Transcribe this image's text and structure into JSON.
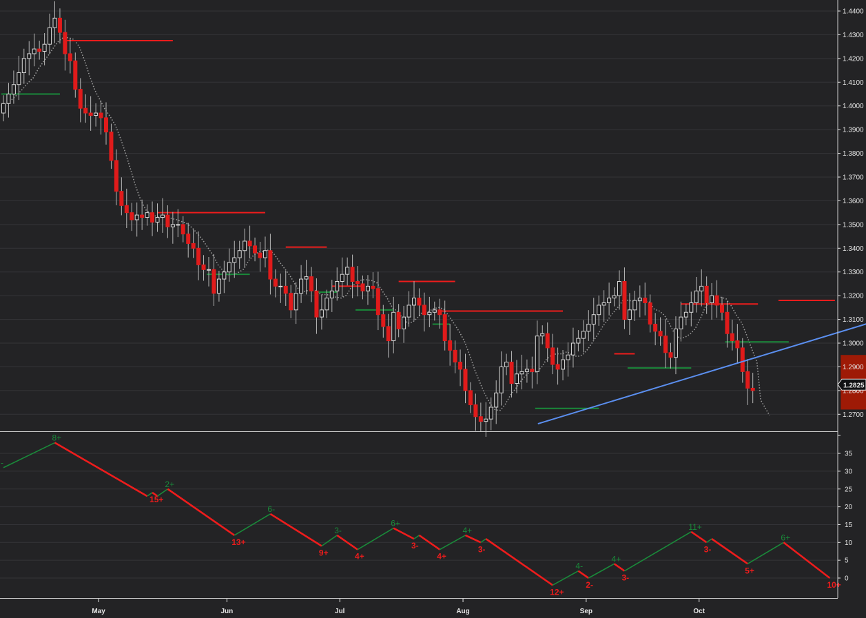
{
  "colors": {
    "background": "#232325",
    "grid": "#343438",
    "up_candle": "#d9d9d9",
    "down_candle": "#e01b1b",
    "wick": "#b8b8b8",
    "red_line": "#ee1c1c",
    "green_line": "#1a8a3a",
    "trendline": "#5b8ff0",
    "target_box": "#9e1a06",
    "ma": "#9a9a9a",
    "axis_text": "#e6e6e6"
  },
  "chart_data": [
    {
      "type": "candlestick",
      "title": "",
      "ylim": [
        1.262,
        1.446
      ],
      "yticks": [
        "1.2700",
        "1.2800",
        "1.2900",
        "1.3000",
        "1.3100",
        "1.3200",
        "1.3300",
        "1.3400",
        "1.3500",
        "1.3600",
        "1.3700",
        "1.3800",
        "1.3900",
        "1.4000",
        "1.4100",
        "1.4200",
        "1.4300",
        "1.4400"
      ],
      "xticks": [
        "May",
        "Jun",
        "Jul",
        "Aug",
        "Sep",
        "Oct"
      ],
      "last_price_label": "1.2825",
      "last_price": 1.2825,
      "closes": [
        1.401,
        1.405,
        1.409,
        1.414,
        1.42,
        1.422,
        1.424,
        1.423,
        1.426,
        1.433,
        1.437,
        1.431,
        1.422,
        1.419,
        1.407,
        1.399,
        1.397,
        1.396,
        1.397,
        1.395,
        1.389,
        1.377,
        1.364,
        1.358,
        1.355,
        1.352,
        1.354,
        1.353,
        1.355,
        1.351,
        1.353,
        1.354,
        1.349,
        1.35,
        1.35,
        1.346,
        1.342,
        1.34,
        1.333,
        1.331,
        1.331,
        1.321,
        1.327,
        1.33,
        1.334,
        1.336,
        1.339,
        1.343,
        1.341,
        1.338,
        1.336,
        1.339,
        1.327,
        1.324,
        1.324,
        1.321,
        1.314,
        1.321,
        1.327,
        1.328,
        1.322,
        1.311,
        1.314,
        1.319,
        1.322,
        1.326,
        1.329,
        1.332,
        1.326,
        1.325,
        1.322,
        1.324,
        1.323,
        1.312,
        1.307,
        1.301,
        1.313,
        1.306,
        1.311,
        1.316,
        1.319,
        1.316,
        1.312,
        1.313,
        1.314,
        1.312,
        1.301,
        1.297,
        1.292,
        1.289,
        1.28,
        1.274,
        1.269,
        1.267,
        1.268,
        1.273,
        1.279,
        1.29,
        1.292,
        1.283,
        1.287,
        1.288,
        1.289,
        1.288,
        1.303,
        1.304,
        1.298,
        1.291,
        1.289,
        1.293,
        1.295,
        1.3,
        1.302,
        1.305,
        1.308,
        1.312,
        1.316,
        1.317,
        1.319,
        1.32,
        1.326,
        1.31,
        1.314,
        1.318,
        1.319,
        1.317,
        1.308,
        1.305,
        1.303,
        1.296,
        1.294,
        1.306,
        1.311,
        1.313,
        1.317,
        1.322,
        1.324,
        1.317,
        1.32,
        1.316,
        1.313,
        1.304,
        1.301,
        1.298,
        1.288,
        1.281,
        1.28
      ],
      "upper_pane": {
        "red_resistance_lines": [
          {
            "from_index": 12,
            "to_index": 33,
            "price": 1.4275
          },
          {
            "from_index": 30,
            "to_index": 51,
            "price": 1.355
          },
          {
            "from_index": 55,
            "to_index": 63,
            "price": 1.3405
          },
          {
            "from_index": 64,
            "to_index": 70,
            "price": 1.324
          },
          {
            "from_index": 77,
            "to_index": 88,
            "price": 1.326
          },
          {
            "from_index": 85,
            "to_index": 109,
            "price": 1.3135
          },
          {
            "from_index": 119,
            "to_index": 123,
            "price": 1.2955
          },
          {
            "from_index": 132,
            "to_index": 147,
            "price": 1.3165
          },
          {
            "from_index": 151,
            "to_index": 162,
            "price": 1.318
          }
        ],
        "green_support_lines": [
          {
            "from_index": 0,
            "to_index": 11,
            "price": 1.405
          },
          {
            "from_index": 40,
            "to_index": 48,
            "price": 1.329
          },
          {
            "from_index": 61,
            "to_index": 65,
            "price": 1.3215
          },
          {
            "from_index": 69,
            "to_index": 76,
            "price": 1.314
          },
          {
            "from_index": 84,
            "to_index": 87,
            "price": 1.308
          },
          {
            "from_index": 104,
            "to_index": 116,
            "price": 1.2725
          },
          {
            "from_index": 122,
            "to_index": 134,
            "price": 1.2895
          },
          {
            "from_index": 141,
            "to_index": 153,
            "price": 1.3005
          }
        ],
        "trendline": [
          {
            "index": 104,
            "price": 1.266
          },
          {
            "index": 169,
            "price": 1.3085
          }
        ],
        "target_box": {
          "from_index": 163,
          "to_index": 169,
          "price_low": 1.272,
          "price_high": 1.295
        }
      }
    },
    {
      "type": "line",
      "title": "",
      "ylim": [
        -5,
        40
      ],
      "yticks": [
        "0",
        "5",
        "10",
        "15",
        "20",
        "25",
        "30",
        "35"
      ],
      "points": [
        {
          "x": 0,
          "y": 31
        },
        {
          "x": 10,
          "y": 38
        },
        {
          "x": 28,
          "y": 23
        },
        {
          "x": 29,
          "y": 24
        },
        {
          "x": 30,
          "y": 23
        },
        {
          "x": 32,
          "y": 25
        },
        {
          "x": 45,
          "y": 12
        },
        {
          "x": 52,
          "y": 18
        },
        {
          "x": 62,
          "y": 9
        },
        {
          "x": 65,
          "y": 12
        },
        {
          "x": 69,
          "y": 8
        },
        {
          "x": 76,
          "y": 14
        },
        {
          "x": 80,
          "y": 11
        },
        {
          "x": 81,
          "y": 12
        },
        {
          "x": 85,
          "y": 8
        },
        {
          "x": 90,
          "y": 12
        },
        {
          "x": 93,
          "y": 10
        },
        {
          "x": 94,
          "y": 11
        },
        {
          "x": 107,
          "y": -2
        },
        {
          "x": 112,
          "y": 2
        },
        {
          "x": 114,
          "y": 0
        },
        {
          "x": 119,
          "y": 4
        },
        {
          "x": 121,
          "y": 2
        },
        {
          "x": 134,
          "y": 13
        },
        {
          "x": 137,
          "y": 10
        },
        {
          "x": 138,
          "y": 11
        },
        {
          "x": 145,
          "y": 4
        },
        {
          "x": 152,
          "y": 10
        },
        {
          "x": 161,
          "y": 0
        }
      ],
      "wave_labels": [
        {
          "x": 0,
          "y": 31,
          "text": "-",
          "dir": "up"
        },
        {
          "x": 10,
          "y": 38,
          "text": "8+",
          "dir": "up"
        },
        {
          "x": 29,
          "y": 24,
          "text": "15+",
          "dir": "down"
        },
        {
          "x": 32,
          "y": 25,
          "text": "2+",
          "dir": "up"
        },
        {
          "x": 45,
          "y": 12,
          "text": "13+",
          "dir": "down"
        },
        {
          "x": 52,
          "y": 18,
          "text": "6-",
          "dir": "up"
        },
        {
          "x": 62,
          "y": 9,
          "text": "9+",
          "dir": "down"
        },
        {
          "x": 65,
          "y": 12,
          "text": "3-",
          "dir": "up"
        },
        {
          "x": 69,
          "y": 8,
          "text": "4+",
          "dir": "down"
        },
        {
          "x": 76,
          "y": 14,
          "text": "6+",
          "dir": "up"
        },
        {
          "x": 80,
          "y": 11,
          "text": "3-",
          "dir": "down"
        },
        {
          "x": 85,
          "y": 8,
          "text": "4+",
          "dir": "down"
        },
        {
          "x": 90,
          "y": 12,
          "text": "4+",
          "dir": "up"
        },
        {
          "x": 93,
          "y": 10,
          "text": "3-",
          "dir": "down"
        },
        {
          "x": 107,
          "y": -2,
          "text": "12+",
          "dir": "down"
        },
        {
          "x": 112,
          "y": 2,
          "text": "4-",
          "dir": "up"
        },
        {
          "x": 114,
          "y": 0,
          "text": "2-",
          "dir": "down"
        },
        {
          "x": 119,
          "y": 4,
          "text": "4+",
          "dir": "up"
        },
        {
          "x": 121,
          "y": 2,
          "text": "3-",
          "dir": "down"
        },
        {
          "x": 134,
          "y": 13,
          "text": "11+",
          "dir": "up"
        },
        {
          "x": 137,
          "y": 10,
          "text": "3-",
          "dir": "down"
        },
        {
          "x": 145,
          "y": 4,
          "text": "5+",
          "dir": "down"
        },
        {
          "x": 152,
          "y": 10,
          "text": "6+",
          "dir": "up"
        },
        {
          "x": 161,
          "y": 0,
          "text": "10+",
          "dir": "down"
        }
      ]
    }
  ]
}
